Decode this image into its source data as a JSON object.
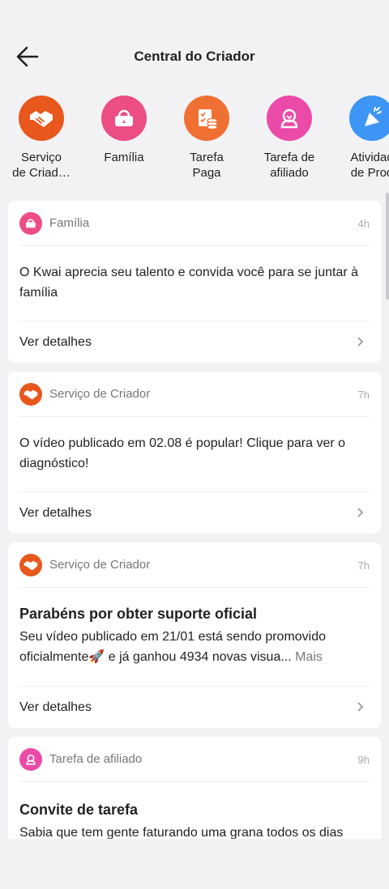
{
  "header": {
    "title": "Central do Criador"
  },
  "categories": [
    {
      "label": "Serviço\nde Criad…",
      "icon": "handshake-icon",
      "color": "#e8571c"
    },
    {
      "label": "Família",
      "icon": "family-icon",
      "color": "#ec4d83"
    },
    {
      "label": "Tarefa\nPaga",
      "icon": "paid-task-icon",
      "color": "#f07033"
    },
    {
      "label": "Tarefa de\nafiliado",
      "icon": "affiliate-icon",
      "color": "#ec4aa8"
    },
    {
      "label": "Atividad\nde Prod",
      "icon": "megaphone-icon",
      "color": "#3d95f5"
    }
  ],
  "cards": [
    {
      "source": "Família",
      "time": "4h",
      "title": "",
      "text": "O Kwai aprecia seu talento e convida você para se juntar à família",
      "more": "",
      "footer": "Ver detalhes"
    },
    {
      "source": "Serviço de Criador",
      "time": "7h",
      "title": "",
      "text": "O vídeo publicado em 02.08 é popular! Clique para ver o diagnóstico!",
      "more": "",
      "footer": "Ver detalhes"
    },
    {
      "source": "Serviço de Criador",
      "time": "7h",
      "title": "Parabéns por obter suporte oficial",
      "text": "Seu vídeo publicado em 21/01 está sendo promovido oficialmente🚀 e já ganhou 4934 novas visua...",
      "more": "Mais",
      "footer": "Ver detalhes"
    },
    {
      "source": "Tarefa de afiliado",
      "time": "9h",
      "title": "Convite de tarefa",
      "text": "Sabia que tem gente faturando uma grana todos os dias",
      "more": "",
      "footer": ""
    }
  ]
}
